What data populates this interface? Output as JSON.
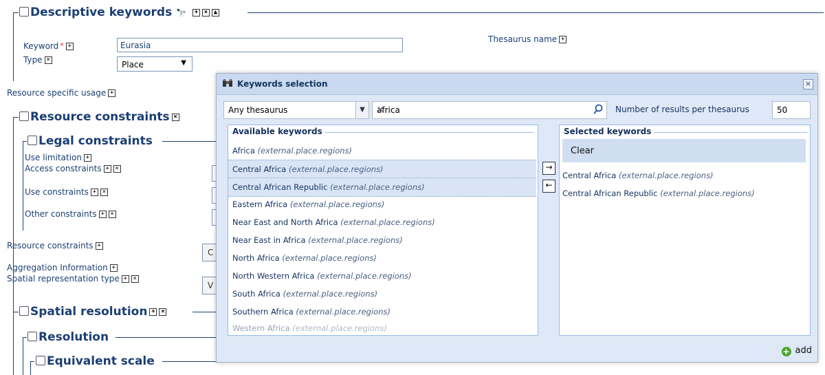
{
  "form": {
    "descriptive_keywords": "Descriptive keywords",
    "keyword_label": "Keyword",
    "keyword_required": "*",
    "keyword_value": "Eurasia",
    "type_label": "Type",
    "type_value": "Place",
    "thesaurus_name_label": "Thesaurus name",
    "resource_specific_usage": "Resource specific usage",
    "resource_constraints_heading": "Resource constraints",
    "legal_constraints": "Legal constraints",
    "use_limitation": "Use limitation",
    "access_constraints": "Access constraints",
    "use_constraints": "Use constraints",
    "other_constraints": "Other constraints",
    "resource_constraints_row": "Resource constraints",
    "aggregation_information": "Aggregation Information",
    "spatial_representation_type": "Spatial representation type",
    "spatial_resolution": "Spatial resolution",
    "resolution": "Resolution",
    "equivalent_scale": "Equivalent scale",
    "partial_button_c": "C",
    "partial_button_v": "V"
  },
  "dialog": {
    "title": "Keywords selection",
    "thesaurus_select": "Any thesaurus",
    "search_value": "africa",
    "results_label": "Number of results per thesaurus",
    "results_value": "50",
    "available_heading": "Available keywords",
    "selected_heading": "Selected keywords",
    "clear_label": "Clear",
    "add_label": "add",
    "available": [
      {
        "name": "Africa",
        "thesaurus": "(external.place.regions)",
        "selected": false
      },
      {
        "name": "Central Africa",
        "thesaurus": "(external.place.regions)",
        "selected": true
      },
      {
        "name": "Central African Republic",
        "thesaurus": "(external.place.regions)",
        "selected": true
      },
      {
        "name": "Eastern Africa",
        "thesaurus": "(external.place.regions)",
        "selected": false
      },
      {
        "name": "Near East and North Africa",
        "thesaurus": "(external.place.regions)",
        "selected": false
      },
      {
        "name": "Near East in Africa",
        "thesaurus": "(external.place.regions)",
        "selected": false
      },
      {
        "name": "North Africa",
        "thesaurus": "(external.place.regions)",
        "selected": false
      },
      {
        "name": "North Western Africa",
        "thesaurus": "(external.place.regions)",
        "selected": false
      },
      {
        "name": "South Africa",
        "thesaurus": "(external.place.regions)",
        "selected": false
      },
      {
        "name": "Southern Africa",
        "thesaurus": "(external.place.regions)",
        "selected": false
      }
    ],
    "selected": [
      {
        "name": "Central Africa",
        "thesaurus": "(external.place.regions)"
      },
      {
        "name": "Central African Republic",
        "thesaurus": "(external.place.regions)"
      }
    ]
  }
}
